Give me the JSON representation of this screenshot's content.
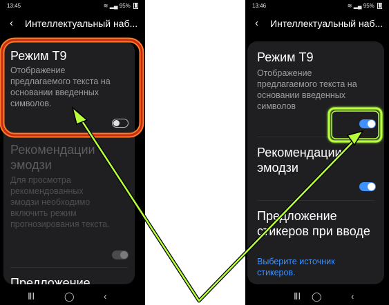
{
  "left": {
    "status": {
      "time": "13:45",
      "battery": "95%"
    },
    "header": {
      "title": "Интеллектуальный наб..."
    },
    "items": [
      {
        "title": "Режим T9",
        "desc": "Отображение предлагаемого текста на основании введенных символов.",
        "toggle": "off"
      },
      {
        "title": "Рекомендации эмодзи",
        "desc": "Для просмотра рекомендованных эмодзи необходимо включить режим прогнозирования текста.",
        "toggle": "disabled-on"
      },
      {
        "title": "Предложение"
      }
    ]
  },
  "right": {
    "status": {
      "time": "13:46",
      "battery": "95%"
    },
    "header": {
      "title": "Интеллектуальный наб..."
    },
    "items": [
      {
        "title": "Режим T9",
        "desc": "Отображение предлагаемого текста на основании введенных символов",
        "toggle": "on"
      },
      {
        "title": "Рекомендации эмодзи",
        "toggle": "on"
      },
      {
        "title": "Предложение стикеров при вводе",
        "link": "Выберите источник стикеров."
      }
    ]
  },
  "colors": {
    "accent": "#3e91ff",
    "highlight_red": "#e0441e",
    "highlight_green": "#b6ff3b",
    "arrow": "#b6ff3b"
  },
  "icons": {
    "back": "back-arrow-icon",
    "nav_recent": "recent-apps-icon",
    "nav_home": "home-icon",
    "nav_back": "nav-back-icon"
  }
}
